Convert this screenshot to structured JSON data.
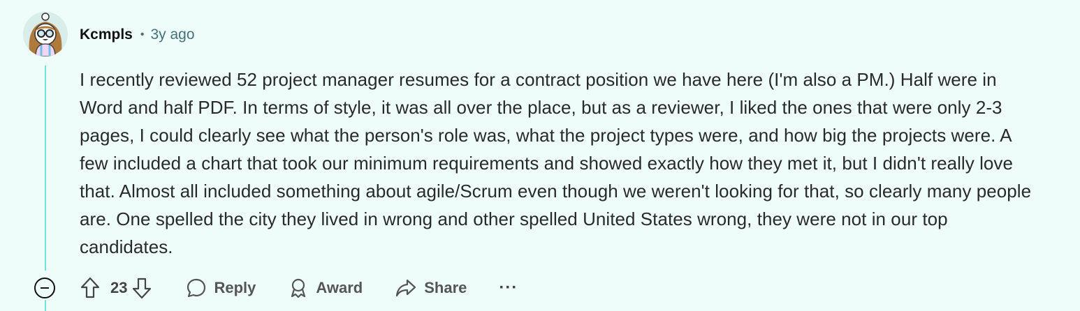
{
  "comment": {
    "author": "Kcmpls",
    "separator": "•",
    "time": "3y ago",
    "body": "I recently reviewed 52 project manager resumes for a contract position we have here (I'm also a PM.) Half were in Word and half PDF. In terms of style, it was all over the place, but as a reviewer, I liked the ones that were only 2-3 pages, I could clearly see what the person's role was, what the project types were, and how big the projects were. A few included a chart that took our minimum requirements and showed exactly how they met it, but I didn't really love that. Almost all included something about agile/Scrum even though we weren't looking for that, so clearly many people are. One spelled the city they lived in wrong and other spelled United States wrong, they were not in our top candidates.",
    "votes": "23"
  },
  "actions": {
    "reply_label": "Reply",
    "award_label": "Award",
    "share_label": "Share",
    "more_label": "···"
  },
  "icons": {
    "collapse": "minus-circle-icon",
    "upvote": "arrow-up-icon",
    "downvote": "arrow-down-icon",
    "reply": "speech-bubble-icon",
    "award": "award-icon",
    "share": "share-arrow-icon",
    "more": "ellipsis-icon"
  },
  "colors": {
    "background": "#eefcfa",
    "thread_line": "#74e4d8",
    "timestamp": "#43727a"
  }
}
